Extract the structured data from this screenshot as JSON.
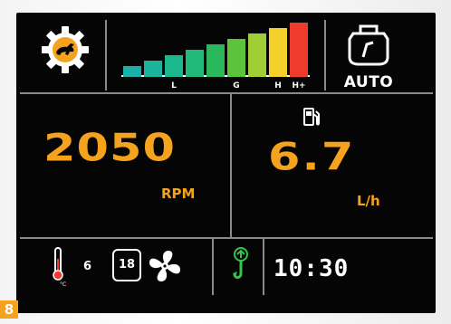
{
  "top": {
    "drive_mode_icon": "rabbit-gear-icon",
    "mode_bars": {
      "labels": [
        "",
        "",
        "L",
        "",
        "",
        "G",
        "",
        "H",
        "H+"
      ],
      "colors": [
        "#1bb1a8",
        "#1cb39d",
        "#1db78e",
        "#20b978",
        "#2bb85c",
        "#5cc33b",
        "#9fcf35",
        "#f5d02a",
        "#ef3b2c"
      ]
    },
    "auto_icon": "engine-auto-icon",
    "auto_label": "AUTO"
  },
  "middle": {
    "rpm_value": "2050",
    "rpm_unit": "RPM",
    "fuel_icon": "fuel-pump-icon",
    "fuel_rate_value": "6.7",
    "fuel_rate_unit": "L/h"
  },
  "bottom": {
    "thermometer_icon": "thermometer-icon",
    "temp_unit": "°C",
    "temp_value": "6",
    "gear_value": "18",
    "fan_icon": "fan-icon",
    "hook_icon": "hook-up-icon",
    "time": "10:30"
  },
  "page_number": "8",
  "colors": {
    "accent": "#f5a21c",
    "screen": "#050505",
    "divider": "#8a8a8a",
    "hook_green": "#34c44a"
  }
}
